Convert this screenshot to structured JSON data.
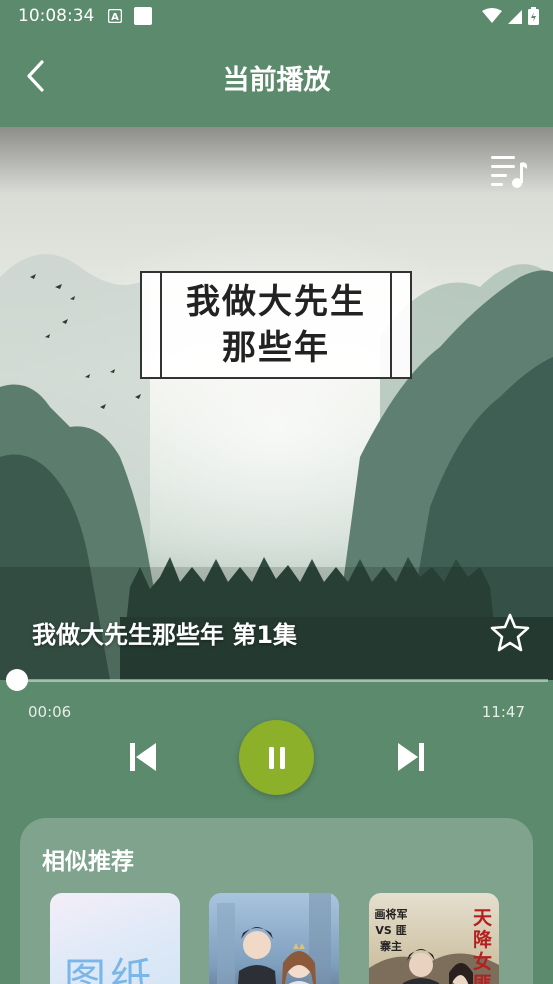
{
  "status_bar": {
    "time": "10:08:34",
    "left_icons": [
      "a-notification-icon",
      "square-notification-icon"
    ],
    "right_icons": [
      "wifi-icon",
      "signal-icon",
      "battery-icon"
    ]
  },
  "header": {
    "back_icon": "chevron-left-icon",
    "title": "当前播放"
  },
  "cover": {
    "title_lines": [
      "我做大先生",
      "那些年"
    ],
    "playlist_icon": "playlist-icon"
  },
  "episode": {
    "title": "我做大先生那些年 第1集",
    "favorite_icon": "star-outline-icon"
  },
  "playback": {
    "current_time": "00:06",
    "total_time": "11:47",
    "progress_fraction": 0.0085,
    "state": "playing",
    "prev_icon": "skip-previous-icon",
    "pause_icon": "pause-icon",
    "next_icon": "skip-next-icon",
    "accent_color": "#8cb02a"
  },
  "recommendations": {
    "heading": "相似推荐",
    "items": [
      {
        "cover_text": "图纸"
      },
      {
        "cover_text": ""
      },
      {
        "cover_text_left": "画将军 VS 匪寨主",
        "cover_text_right": "天降女匪"
      }
    ]
  },
  "colors": {
    "background": "#5b8a6c",
    "card": "rgba(255,255,255,0.22)"
  }
}
